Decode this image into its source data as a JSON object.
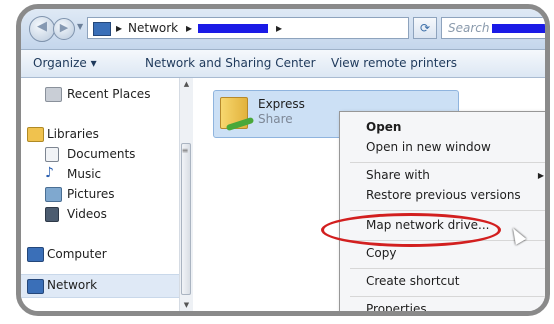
{
  "address_bar": {
    "crumbs": [
      "Network"
    ],
    "search_placeholder": "Search",
    "refresh_glyph": "⟳"
  },
  "command_bar": {
    "organize": "Organize ▾",
    "network_center": "Network and Sharing Center",
    "remote_printers": "View remote printers"
  },
  "nav_pane": {
    "recent": "Recent Places",
    "libraries": "Libraries",
    "documents": "Documents",
    "music": "Music",
    "pictures": "Pictures",
    "videos": "Videos",
    "computer": "Computer",
    "network": "Network"
  },
  "content": {
    "item_name": "Express",
    "item_type": "Share"
  },
  "context_menu": {
    "open": "Open",
    "open_new": "Open in new window",
    "share_with": "Share with",
    "restore": "Restore previous versions",
    "map_drive": "Map network drive...",
    "copy": "Copy",
    "create_shortcut": "Create shortcut",
    "properties": "Properties"
  },
  "colors": {
    "highlight_ring": "#d21f1f",
    "redaction": "#1a1ae6"
  }
}
